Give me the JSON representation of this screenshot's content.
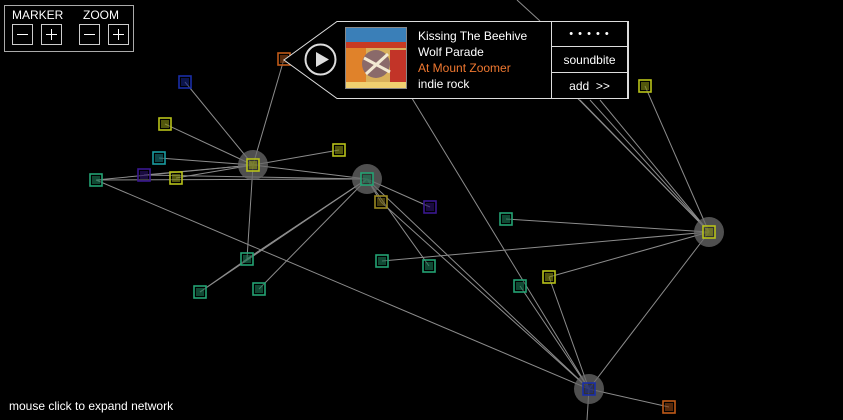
{
  "controls": {
    "marker_label": "MARKER",
    "zoom_label": "ZOOM"
  },
  "track": {
    "title": "Kissing The Beehive",
    "artist": "Wolf Parade",
    "album": "At Mount Zoomer",
    "genre": "indie rock",
    "album_color": "#f07830"
  },
  "popup": {
    "rating_label": "• • • • •",
    "soundbite_label": "soundbite",
    "add_label": "add  >>"
  },
  "status": {
    "hint": "mouse click to expand network"
  },
  "icons": {
    "play": "play-icon",
    "minus": "minus-icon",
    "plus": "plus-icon"
  },
  "palette": {
    "background": "#000000",
    "edge": "#8c8c8c",
    "hub_halo": "#6a6a6a",
    "node_yellow": "#b8c21a",
    "node_green": "#23a374",
    "node_teal": "#1a9ca0",
    "node_blue": "#1a2ea8",
    "node_purple": "#3a1890",
    "node_olive": "#9c8a20",
    "node_orange": "#c05a18",
    "accent": "#f07830"
  }
}
